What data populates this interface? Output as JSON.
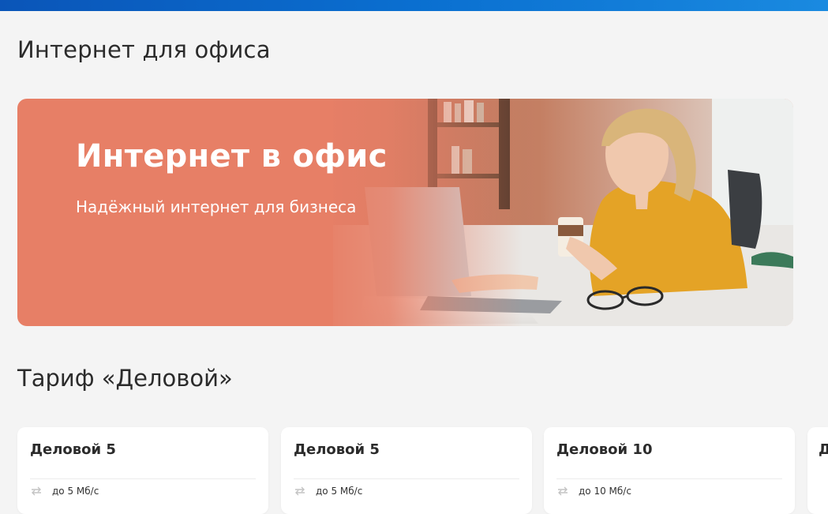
{
  "page": {
    "title": "Интернет для офиса"
  },
  "hero": {
    "title": "Интернет в офис",
    "subtitle": "Надёжный интернет для бизнеса",
    "background_color": "#e77f66"
  },
  "tariff_section": {
    "title": "Тариф «Деловой»",
    "cards": [
      {
        "name": "Деловой 5",
        "speed": "до 5 Мб/с",
        "icon": "transfer-arrows-icon"
      },
      {
        "name": "Деловой 5",
        "speed": "до 5 Мб/с",
        "icon": "transfer-arrows-icon"
      },
      {
        "name": "Деловой 10",
        "speed": "до 10 Мб/с",
        "icon": "transfer-arrows-icon"
      },
      {
        "name": "Д",
        "speed": "",
        "icon": ""
      }
    ]
  },
  "colors": {
    "top_bar": "#0a6fd0",
    "background": "#f4f4f4",
    "card": "#ffffff"
  }
}
